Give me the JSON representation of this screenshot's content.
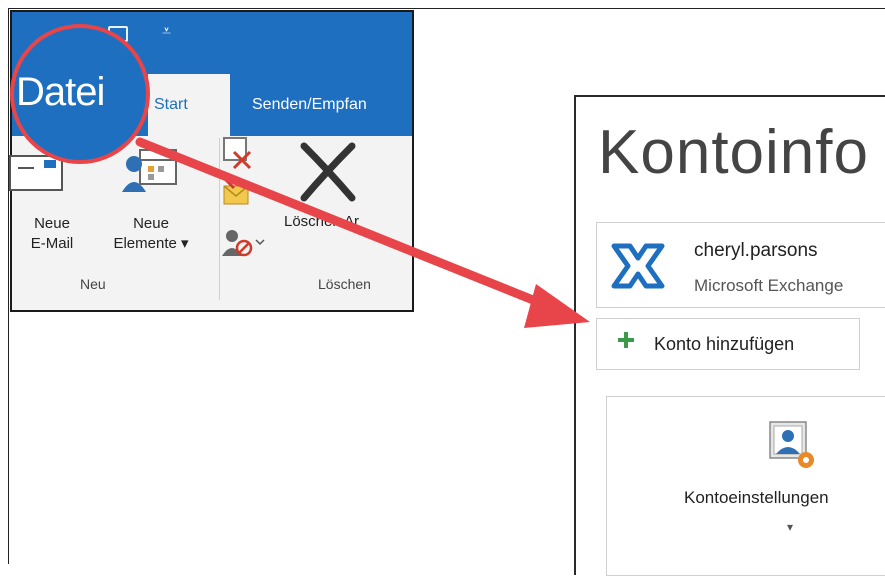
{
  "ribbon": {
    "file_tab": "Datei",
    "tabs": [
      {
        "label": "Start"
      },
      {
        "label": "Senden/Empfan"
      }
    ],
    "buttons": {
      "new_email_line1": "Neue",
      "new_email_line2": "E-Mail",
      "new_items_line1": "Neue",
      "new_items_line2": "Elemente ▾",
      "delete_label": "Löschen Ar"
    },
    "groups": {
      "new": "Neu",
      "delete": "Löschen"
    },
    "accent_color": "#1e6fbf"
  },
  "account_panel": {
    "title": "Kontoinfo",
    "account_name": "cheryl.parsons",
    "account_type": "Microsoft Exchange",
    "add_account_label": "Konto hinzufügen",
    "account_settings_label": "Kontoeinstellungen",
    "account_settings_caret": "▾"
  },
  "annotation": {
    "highlight_color": "#e8454a"
  }
}
